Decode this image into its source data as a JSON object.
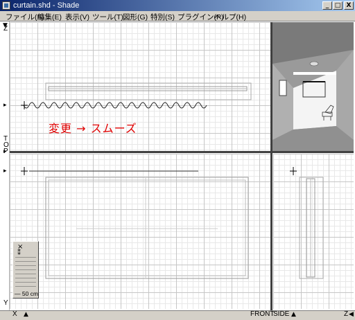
{
  "window": {
    "title": "curtain.shd - Shade",
    "minimize": "_",
    "maximize": "□",
    "close": "X"
  },
  "menu": [
    "ファイル(F)",
    "編集(E)",
    "表示(V)",
    "ツール(T)",
    "図形(G)",
    "特別(S)",
    "プラグイン(P)",
    "ヘルプ(H)"
  ],
  "views": {
    "top_label": "T\nO\nP",
    "z_label": "Z",
    "y_label": "Y",
    "x_label": "X",
    "z_right_label": "Z",
    "front_label": "FRONT",
    "side_label": "SIDE"
  },
  "annotation": "変更 → スムーズ",
  "tool_palette": {
    "close": "×",
    "scale": "50 cm"
  },
  "colors": {
    "annotation": "#e00000",
    "titlebar_start": "#0a246a",
    "titlebar_end": "#a6caf0"
  }
}
